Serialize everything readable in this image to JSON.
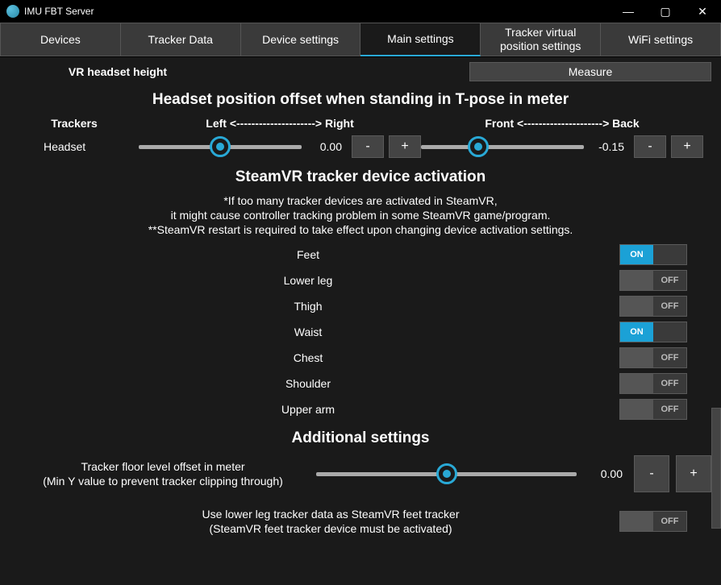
{
  "window": {
    "title": "IMU FBT Server",
    "minimize": "—",
    "maximize": "▢",
    "close": "✕"
  },
  "tabs": [
    {
      "label": "Devices",
      "active": false
    },
    {
      "label": "Tracker Data",
      "active": false
    },
    {
      "label": "Device settings",
      "active": false
    },
    {
      "label": "Main settings",
      "active": true
    },
    {
      "label": "Tracker virtual position settings",
      "active": false
    },
    {
      "label": "WiFi settings",
      "active": false
    }
  ],
  "headsetHeight": {
    "label": "VR headset height",
    "button": "Measure"
  },
  "offsetSection": {
    "title": "Headset position offset when standing in T-pose in meter",
    "colTrackers": "Trackers",
    "colLeftRight": "Left <---------------------> Right",
    "colFrontBack": "Front <---------------------> Back",
    "rows": [
      {
        "name": "Headset",
        "lr": {
          "value": "0.00",
          "pos": 50
        },
        "fb": {
          "value": "-0.15",
          "pos": 35
        }
      }
    ],
    "minus": "-",
    "plus": "+"
  },
  "activationSection": {
    "title": "SteamVR tracker device activation",
    "note1": "*If too many tracker devices are activated in SteamVR,",
    "note2": "it might cause controller tracking problem in some SteamVR game/program.",
    "note3": "**SteamVR restart is required to take effect upon changing device activation settings.",
    "onText": "ON",
    "offText": "OFF",
    "trackers": [
      {
        "name": "Feet",
        "on": true
      },
      {
        "name": "Lower leg",
        "on": false
      },
      {
        "name": "Thigh",
        "on": false
      },
      {
        "name": "Waist",
        "on": true
      },
      {
        "name": "Chest",
        "on": false
      },
      {
        "name": "Shoulder",
        "on": false
      },
      {
        "name": "Upper arm",
        "on": false
      }
    ]
  },
  "additionalSection": {
    "title": "Additional settings",
    "floorLabel1": "Tracker floor level offset in meter",
    "floorLabel2": "(Min Y value to prevent tracker clipping through)",
    "floorValue": "0.00",
    "floorPos": 50,
    "minus": "-",
    "plus": "+",
    "useLower1": "Use lower leg tracker data as SteamVR feet tracker",
    "useLower2": "(SteamVR feet tracker device must be activated)",
    "useLowerOn": false
  }
}
